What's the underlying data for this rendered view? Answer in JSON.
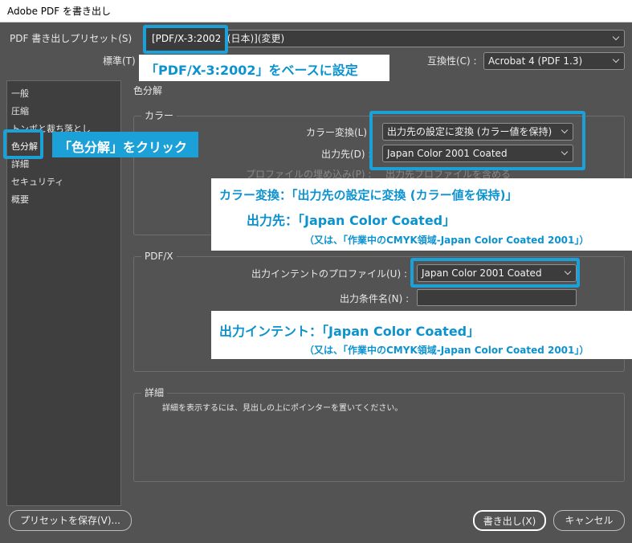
{
  "window": {
    "title": "Adobe PDF を書き出し"
  },
  "preset": {
    "label": "PDF 書き出しプリセット(S)",
    "value": "[PDF/X-3:2002] (日本)](変更)"
  },
  "standard": {
    "label": "標準(T)"
  },
  "compat": {
    "label": "互換性(C) :",
    "value": "Acrobat 4 (PDF 1.3)"
  },
  "sidebar": {
    "items": [
      {
        "label": "一般"
      },
      {
        "label": "圧縮"
      },
      {
        "label": "トンボと裁ち落とし"
      },
      {
        "label": "色分解"
      },
      {
        "label": "詳細"
      },
      {
        "label": "セキュリティ"
      },
      {
        "label": "概要"
      }
    ]
  },
  "panel": {
    "heading": "色分解"
  },
  "color_group": {
    "title": "カラー",
    "conversion_label": "カラー変換(L) :",
    "conversion_value": "出力先の設定に変換 (カラー値を保持)",
    "destination_label": "出力先(D) :",
    "destination_value": "Japan Color 2001 Coated",
    "embed_label": "プロファイルの埋め込み(P) :",
    "embed_value": "出力先プロファイルを含める"
  },
  "pdfx_group": {
    "title": "PDF/X",
    "intent_label": "出力インテントのプロファイル(U) :",
    "intent_value": "Japan Color 2001 Coated",
    "condition_label": "出力条件名(N) :",
    "condition_value": ""
  },
  "detail_group": {
    "title": "詳細",
    "text": "詳細を表示するには、見出しの上にポインターを置いてください。"
  },
  "buttons": {
    "save_preset": "プリセットを保存(V)...",
    "export": "書き出し(X)",
    "cancel": "キャンセル"
  },
  "annotations": {
    "preset_box_text": "[PDF/X-3:2002",
    "preset_note": "「PDF/X-3:2002」をベースに設定",
    "click_note": "「色分解」をクリック",
    "color_note_line1": "カラー変換：「出力先の設定に変換 (カラー値を保持)」",
    "color_note_line2": "出力先：「Japan Color Coated」",
    "color_note_line3": "（又は、「作業中のCMYK領域-Japan Color Coated 2001」）",
    "intent_note_line1": "出力インテント：「Japan Color Coated」",
    "intent_note_line2": "（又は、「作業中のCMYK領域-Japan Color Coated 2001」）"
  },
  "colors": {
    "accent": "#1ba0d8",
    "background": "#535353"
  }
}
